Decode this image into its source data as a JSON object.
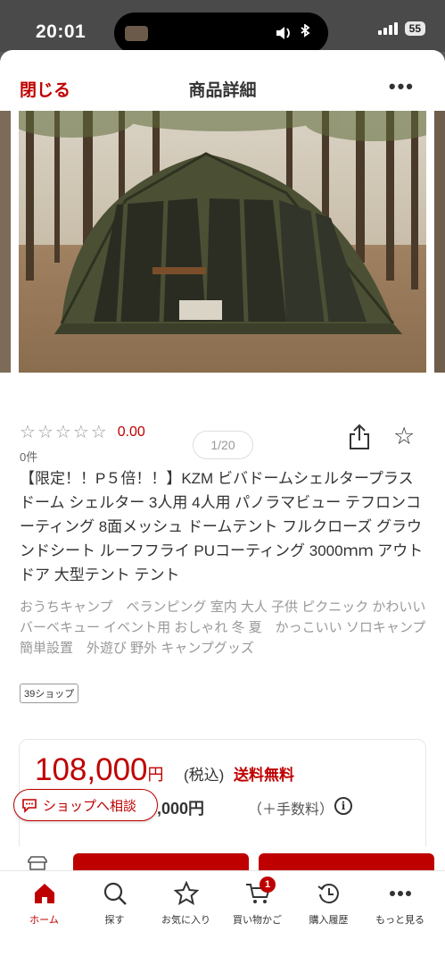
{
  "status_bar": {
    "time": "20:01",
    "battery": "55"
  },
  "header": {
    "close_label": "閉じる",
    "title": "商品詳細",
    "more_label": "•••"
  },
  "gallery": {
    "pager": "1/20"
  },
  "rating": {
    "stars": [
      "☆",
      "☆",
      "☆",
      "☆",
      "☆"
    ],
    "value": "0.00",
    "count": "0件"
  },
  "product": {
    "title": "【限定！！P５倍！！】KZM ビバドームシェルタープラス ドーム シェルター 3人用 4人用 パノラマビュー テフロンコーティング 8面メッシュ ドームテント フルクローズ グラウンドシート ルーフフライ PUコーティング 3000ｍｍ アウトドア 大型テント テント",
    "tags": "おうちキャンプ　ベランピング 室内 大人 子供 ピクニック かわいい バーベキュー イベント用 おしゃれ 冬 夏　かっこいい ソロキャンプ　簡単設置　外遊び 野外 キャンプグッズ",
    "shop_badge": "39ショップ"
  },
  "price": {
    "amount": "108,000",
    "yen": "円",
    "tax": "(税込)",
    "shipping": "送料無料",
    "sub_amount": "36,000円",
    "fee": "（＋手数料）",
    "info": "i"
  },
  "consult": {
    "label": "ショップへ相談"
  },
  "tabbar": {
    "items": [
      {
        "label": "ホーム"
      },
      {
        "label": "探す"
      },
      {
        "label": "お気に入り"
      },
      {
        "label": "買い物かご"
      },
      {
        "label": "購入履歴"
      },
      {
        "label": "もっと見る"
      }
    ],
    "cart_count": "1"
  },
  "colors": {
    "accent": "#bf0000",
    "text": "#333333",
    "muted": "#999999"
  },
  "icons": [
    "share-icon",
    "star-outline-icon",
    "info-icon",
    "chat-icon",
    "home-icon",
    "search-icon",
    "star-icon",
    "cart-icon",
    "history-icon",
    "more-icon"
  ]
}
